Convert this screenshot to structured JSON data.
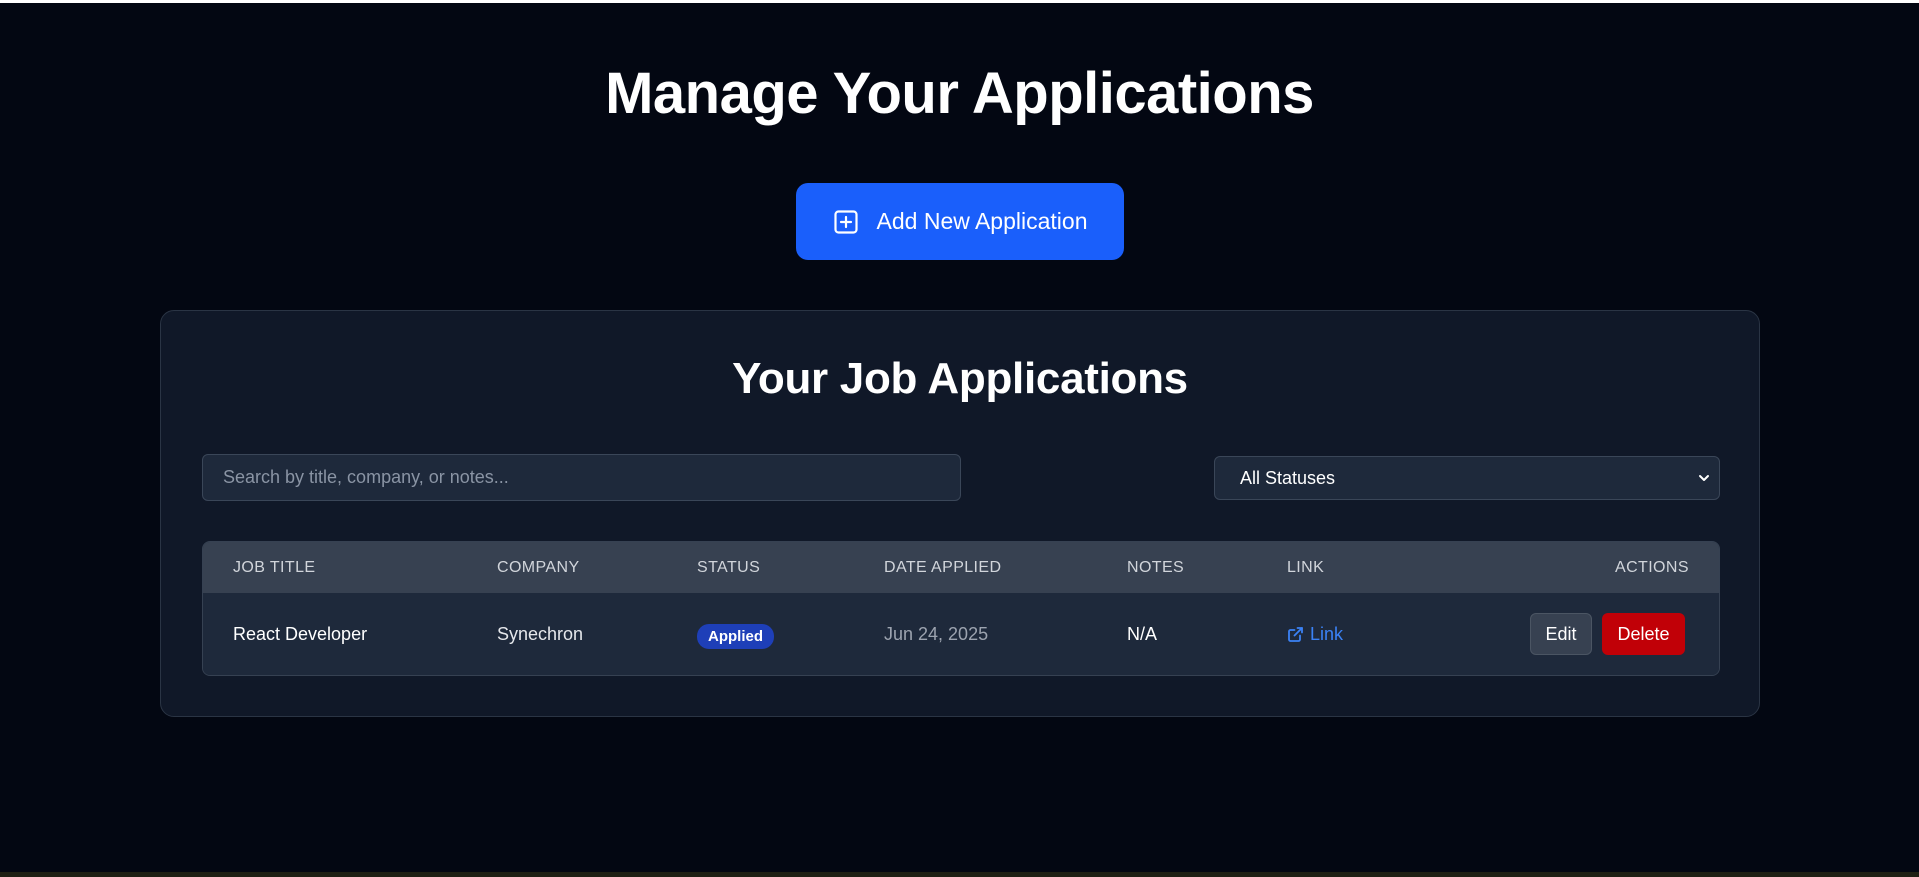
{
  "header": {
    "title": "Manage Your Applications",
    "add_button_label": "Add New Application",
    "add_icon": "plus-square-icon"
  },
  "applications_card": {
    "title": "Your Job Applications",
    "search": {
      "placeholder": "Search by title, company, or notes...",
      "value": ""
    },
    "status_filter": {
      "selected": "All Statuses",
      "icon": "chevron-down-icon"
    },
    "table": {
      "columns": [
        "JOB TITLE",
        "COMPANY",
        "STATUS",
        "DATE APPLIED",
        "NOTES",
        "LINK",
        "ACTIONS"
      ],
      "rows": [
        {
          "job_title": "React Developer",
          "company": "Synechron",
          "status": "Applied",
          "date_applied": "Jun 24, 2025",
          "notes": "N/A",
          "link_label": "Link",
          "link_icon": "external-link-icon",
          "edit_label": "Edit",
          "delete_label": "Delete"
        }
      ]
    }
  },
  "colors": {
    "background": "#030712",
    "card": "#101828",
    "primary": "#1a5ffb",
    "danger": "#c10007",
    "status_applied": "#1e3fb8",
    "link": "#3b82f6"
  }
}
